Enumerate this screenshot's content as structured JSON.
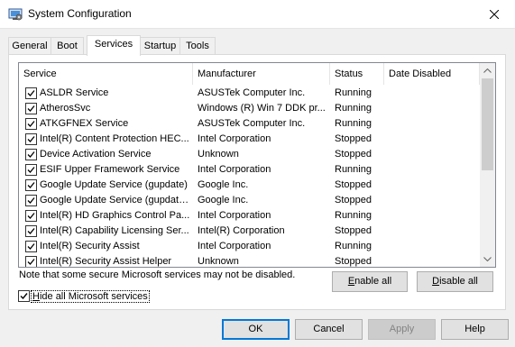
{
  "window": {
    "title": "System Configuration",
    "icon": "msconfig-icon"
  },
  "tabs": [
    {
      "label": "General",
      "active": false
    },
    {
      "label": "Boot",
      "active": false
    },
    {
      "label": "Services",
      "active": true
    },
    {
      "label": "Startup",
      "active": false
    },
    {
      "label": "Tools",
      "active": false
    }
  ],
  "services": {
    "columns": [
      "Service",
      "Manufacturer",
      "Status",
      "Date Disabled"
    ],
    "rows": [
      {
        "checked": true,
        "service": "ASLDR Service",
        "manufacturer": "ASUSTek Computer Inc.",
        "status": "Running",
        "date_disabled": ""
      },
      {
        "checked": true,
        "service": "AtherosSvc",
        "manufacturer": "Windows (R) Win 7 DDK pr...",
        "status": "Running",
        "date_disabled": ""
      },
      {
        "checked": true,
        "service": "ATKGFNEX Service",
        "manufacturer": "ASUSTek Computer Inc.",
        "status": "Running",
        "date_disabled": ""
      },
      {
        "checked": true,
        "service": "Intel(R) Content Protection HEC...",
        "manufacturer": "Intel Corporation",
        "status": "Stopped",
        "date_disabled": ""
      },
      {
        "checked": true,
        "service": "Device Activation Service",
        "manufacturer": "Unknown",
        "status": "Stopped",
        "date_disabled": ""
      },
      {
        "checked": true,
        "service": "ESIF Upper Framework Service",
        "manufacturer": "Intel Corporation",
        "status": "Running",
        "date_disabled": ""
      },
      {
        "checked": true,
        "service": "Google Update Service (gupdate)",
        "manufacturer": "Google Inc.",
        "status": "Stopped",
        "date_disabled": ""
      },
      {
        "checked": true,
        "service": "Google Update Service (gupdatem)",
        "manufacturer": "Google Inc.",
        "status": "Stopped",
        "date_disabled": ""
      },
      {
        "checked": true,
        "service": "Intel(R) HD Graphics Control Pa...",
        "manufacturer": "Intel Corporation",
        "status": "Running",
        "date_disabled": ""
      },
      {
        "checked": true,
        "service": "Intel(R) Capability Licensing Ser...",
        "manufacturer": "Intel(R) Corporation",
        "status": "Stopped",
        "date_disabled": ""
      },
      {
        "checked": true,
        "service": "Intel(R) Security Assist",
        "manufacturer": "Intel Corporation",
        "status": "Running",
        "date_disabled": ""
      },
      {
        "checked": true,
        "service": "Intel(R) Security Assist Helper",
        "manufacturer": "Unknown",
        "status": "Stopped",
        "date_disabled": ""
      }
    ]
  },
  "note": "Note that some secure Microsoft services may not be disabled.",
  "enable_all": {
    "pre": "",
    "accel": "E",
    "post": "nable all"
  },
  "disable_all": {
    "pre": "",
    "accel": "D",
    "post": "isable all"
  },
  "hide_ms": {
    "checked": true,
    "accel": "H",
    "post": "ide all Microsoft services"
  },
  "buttons": {
    "ok": "OK",
    "cancel": "Cancel",
    "apply": "Apply",
    "help": "Help"
  },
  "colors": {
    "accent": "#0078d7",
    "background": "#f0f0f0",
    "disabled_text": "#838383"
  }
}
